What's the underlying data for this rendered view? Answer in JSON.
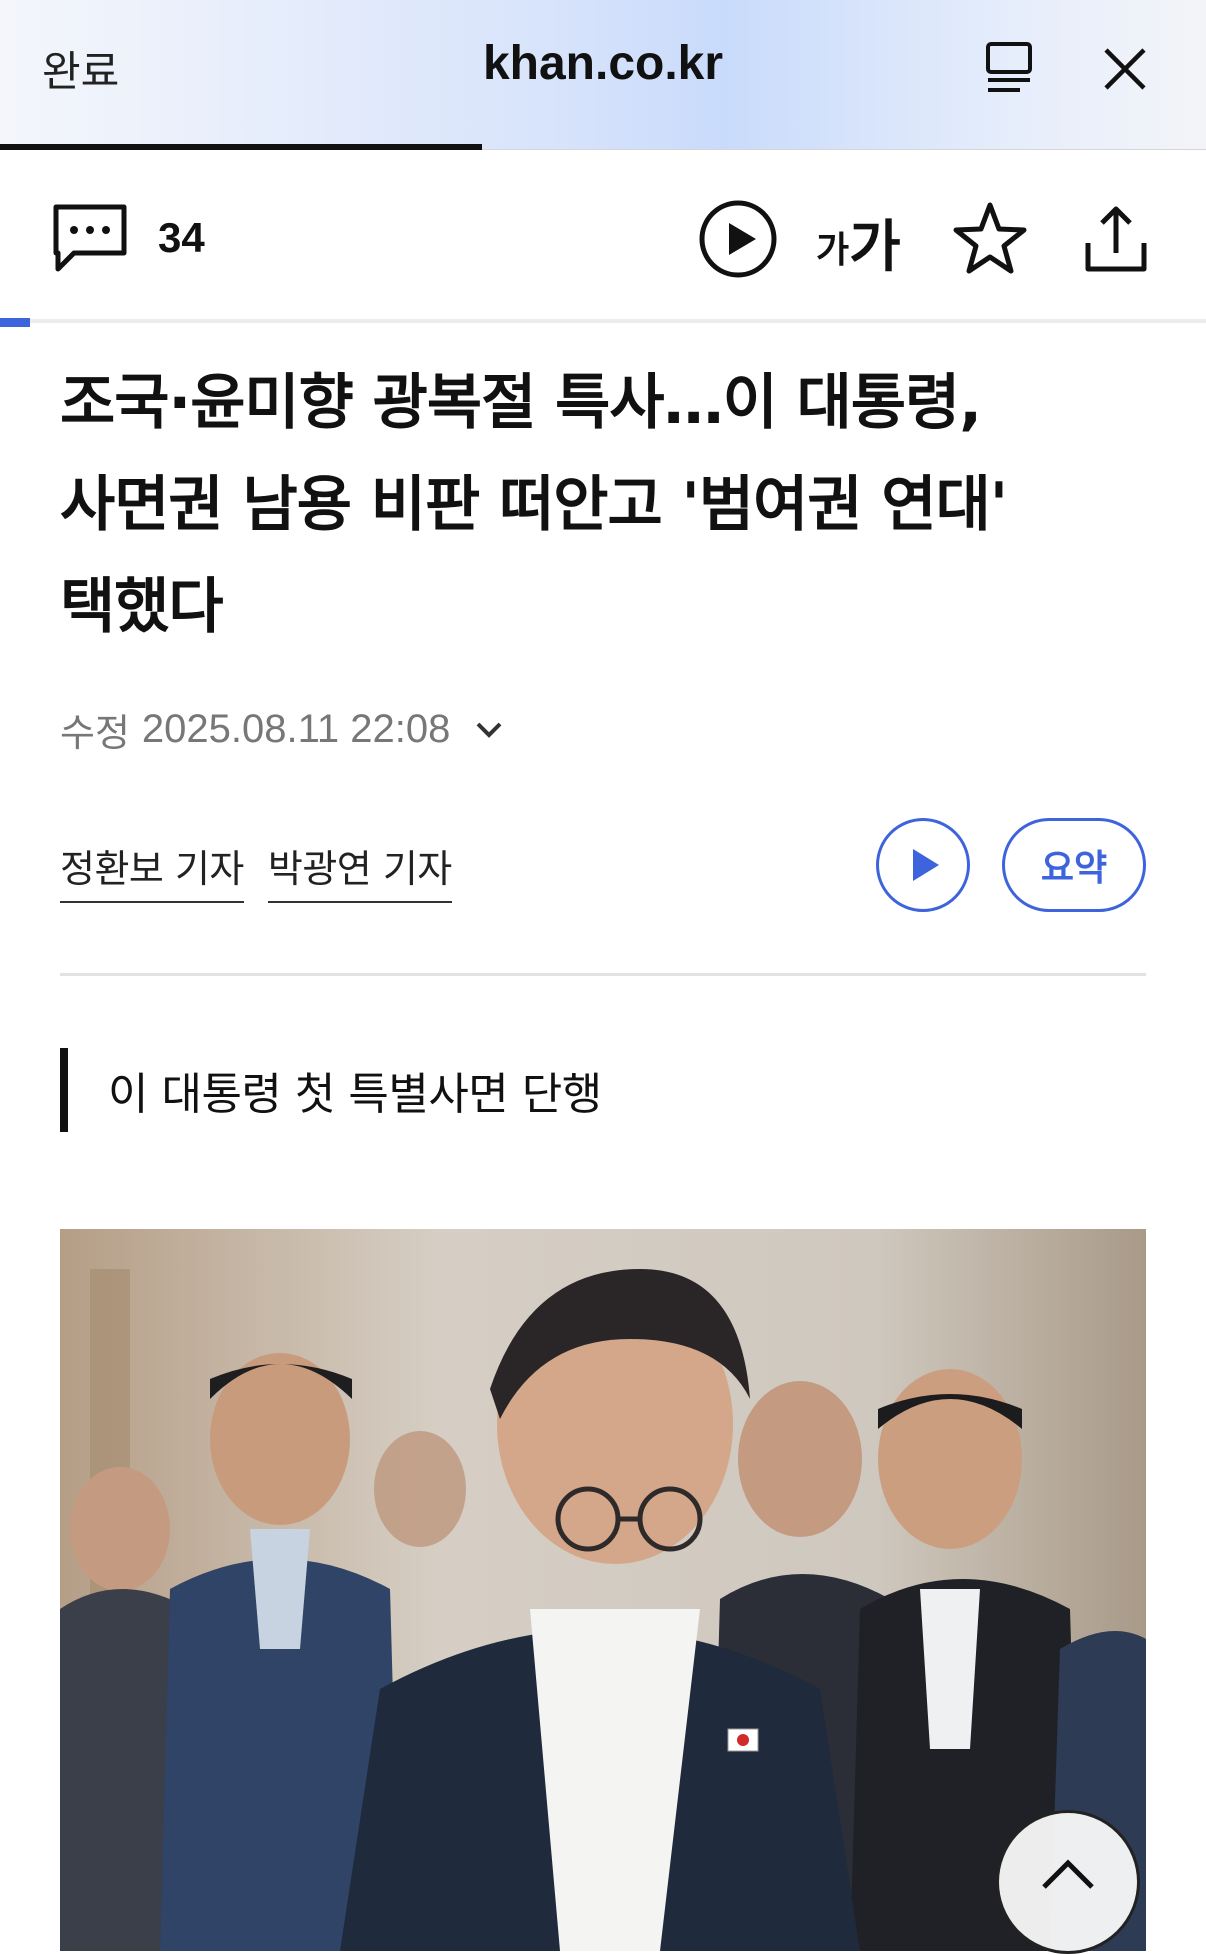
{
  "browser": {
    "done_label": "완료",
    "url": "khan.co.kr",
    "load_progress": 0.4
  },
  "toolbar": {
    "comment_count": "34",
    "font_size_small": "가",
    "font_size_large": "가"
  },
  "article": {
    "headline_line1": "조국·윤미향 광복절 특사…이 대통령,",
    "headline_line2": "사면권 남용 비판 떠안고 '범여권 연대'",
    "headline_line3": "택했다",
    "modified_label": "수정",
    "modified_datetime": "2025.08.11 22:08",
    "reporters": [
      "정환보 기자",
      "박광연 기자"
    ],
    "summary_label": "요약",
    "subheading": "이 대통령 첫 특별사면 단행"
  },
  "colors": {
    "accent": "#3d63dd",
    "text": "#111111",
    "meta": "#777777"
  },
  "icons": {
    "reader": "reader-mode-icon",
    "close": "close-icon",
    "comment": "comment-icon",
    "play": "play-icon",
    "star": "star-icon",
    "share": "share-icon",
    "chevron": "chevron-down-icon",
    "up": "chevron-up-icon"
  }
}
